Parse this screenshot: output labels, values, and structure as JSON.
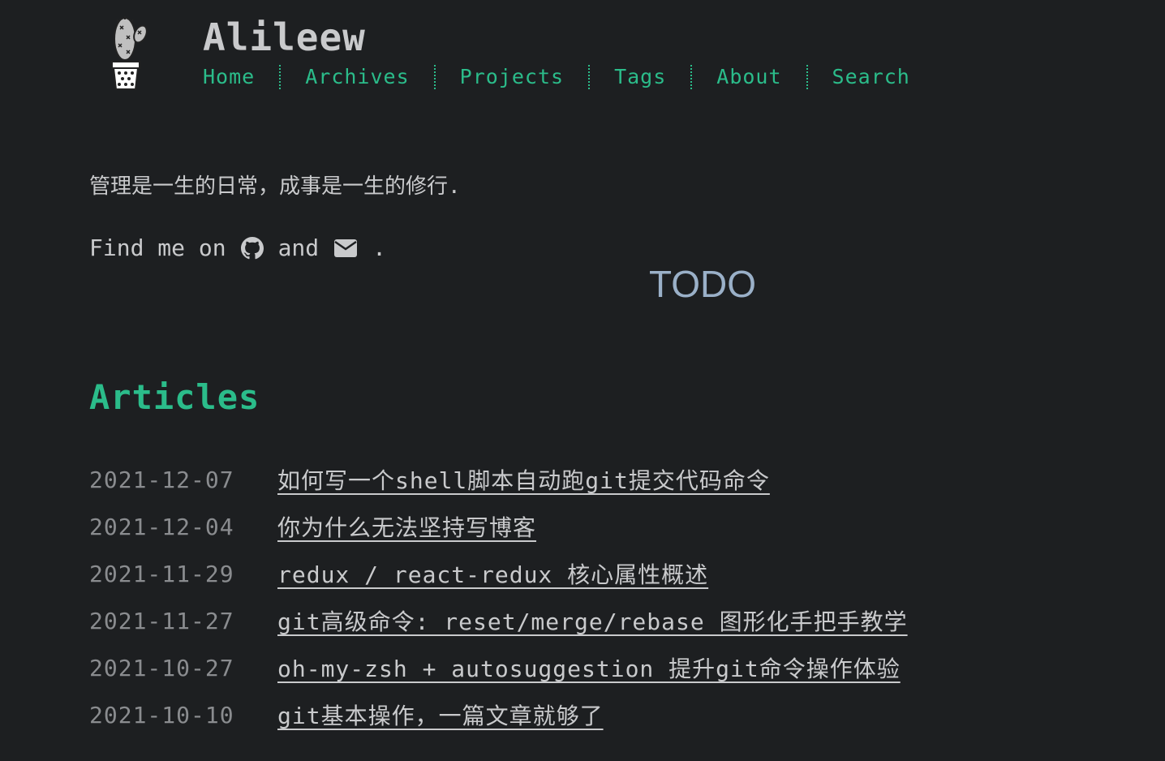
{
  "header": {
    "site_title": "Alileew",
    "nav": [
      {
        "label": "Home"
      },
      {
        "label": "Archives"
      },
      {
        "label": "Projects"
      },
      {
        "label": "Tags"
      },
      {
        "label": "About"
      },
      {
        "label": "Search"
      }
    ]
  },
  "intro": {
    "tagline": "管理是一生的日常，成事是一生的修行.",
    "findme_prefix": "Find me on",
    "findme_and": "and",
    "findme_suffix": ".",
    "github_icon": "github-icon",
    "mail_icon": "envelope-icon"
  },
  "todo_label": "TODO",
  "articles": {
    "title": "Articles",
    "posts": [
      {
        "date": "2021-12-07",
        "title": "如何写一个shell脚本自动跑git提交代码命令"
      },
      {
        "date": "2021-12-04",
        "title": "你为什么无法坚持写博客"
      },
      {
        "date": "2021-11-29",
        "title": "redux / react-redux 核心属性概述"
      },
      {
        "date": "2021-11-27",
        "title": "git高级命令: reset/merge/rebase 图形化手把手教学"
      },
      {
        "date": "2021-10-27",
        "title": "oh-my-zsh + autosuggestion 提升git命令操作体验"
      },
      {
        "date": "2021-10-10",
        "title": "git基本操作，一篇文章就够了"
      }
    ]
  },
  "colors": {
    "background": "#1d1f21",
    "accent": "#2bbc8a",
    "text": "#c9cacc",
    "muted": "#8a8c8f",
    "todo": "#9ab0c8"
  }
}
